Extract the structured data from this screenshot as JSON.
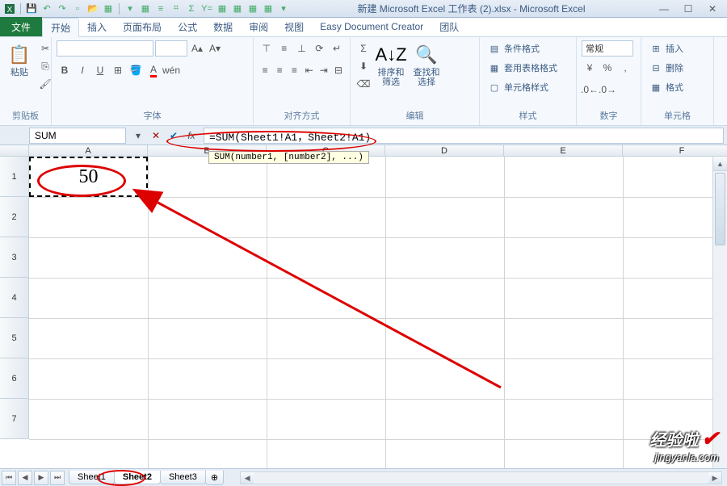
{
  "title": "新建 Microsoft Excel 工作表 (2).xlsx - Microsoft Excel",
  "tabs": {
    "file": "文件",
    "items": [
      "开始",
      "插入",
      "页面布局",
      "公式",
      "数据",
      "审阅",
      "视图",
      "Easy Document Creator",
      "团队"
    ],
    "active": 0
  },
  "ribbon": {
    "clipboard": {
      "label": "剪贴板",
      "paste": "粘贴"
    },
    "font": {
      "label": "字体",
      "name_ph": "",
      "size_ph": "",
      "buttons": [
        "B",
        "I",
        "U"
      ]
    },
    "align": {
      "label": "对齐方式"
    },
    "edit": {
      "label": "编辑",
      "sort": "排序和筛选",
      "find": "查找和选择"
    },
    "styles": {
      "label": "样式",
      "cond": "条件格式",
      "table": "套用表格格式",
      "cell": "单元格样式"
    },
    "number": {
      "label": "数字",
      "general": "常规"
    },
    "cells": {
      "label": "单元格",
      "insert": "插入",
      "delete": "删除",
      "format": "格式"
    }
  },
  "formula_bar": {
    "namebox": "SUM",
    "formula": "=SUM(Sheet1!A1，Sheet2!A1)",
    "tooltip": "SUM(number1, [number2], ...)"
  },
  "grid": {
    "cols": [
      "A",
      "B",
      "C",
      "D",
      "E",
      "F"
    ],
    "rows": [
      "1",
      "2",
      "3",
      "4",
      "5",
      "6",
      "7"
    ],
    "a1_value": "50"
  },
  "sheets": {
    "items": [
      "Sheet1",
      "Sheet2",
      "Sheet3"
    ],
    "active": 1
  },
  "watermark": {
    "line1": "经验啦",
    "line2": "jingyanla.com"
  },
  "chart_data": null
}
